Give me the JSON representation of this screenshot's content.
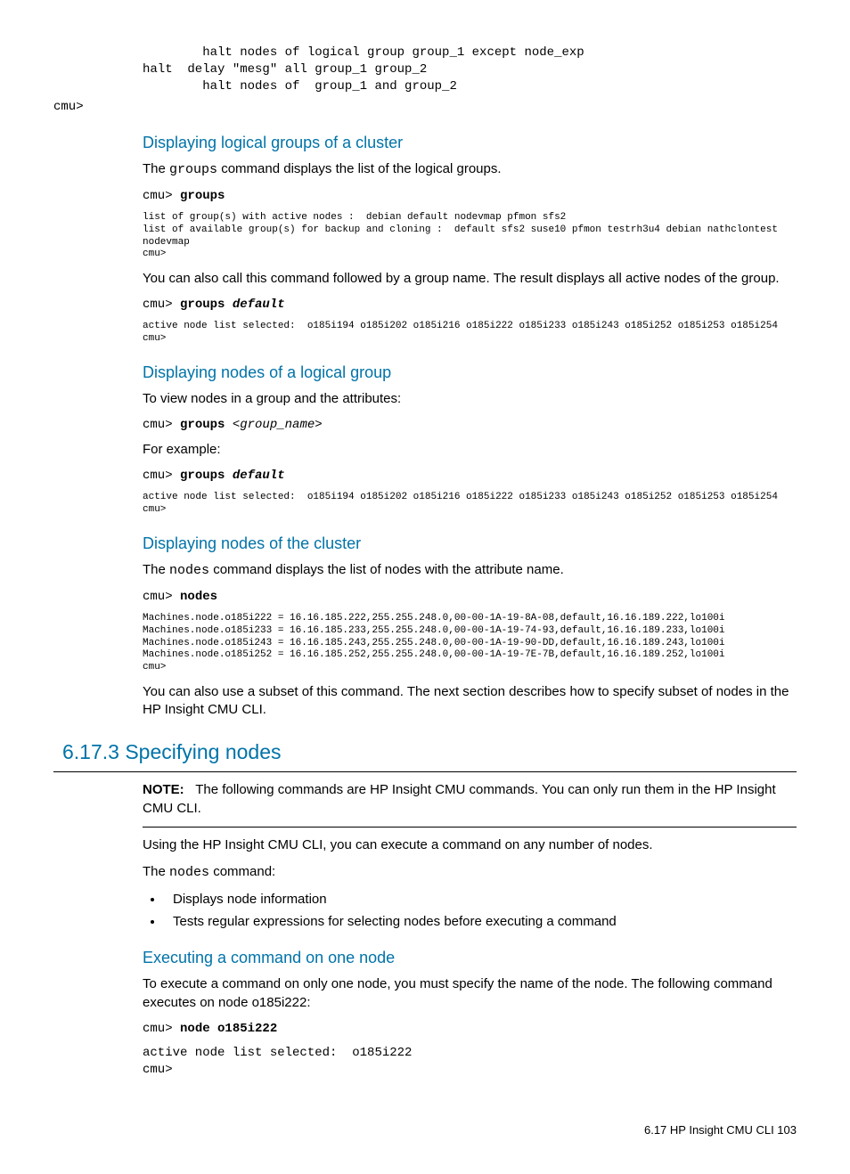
{
  "top_code": "        halt nodes of logical group group_1 except node_exp\nhalt  delay \"mesg\" all group_1 group_2\n        halt nodes of  group_1 and group_2",
  "top_prompt": "cmu>",
  "sec1": {
    "heading": "Displaying logical groups of a cluster",
    "p1a": "The ",
    "p1b": "groups",
    "p1c": " command displays the list of the logical groups.",
    "cmd1_prompt": "cmu> ",
    "cmd1_cmd": "groups",
    "out1": "list of group(s) with active nodes :  debian default nodevmap pfmon sfs2\nlist of available group(s) for backup and cloning :  default sfs2 suse10 pfmon testrh3u4 debian nathclontest nodevmap\ncmu>",
    "p2": "You can also call this command followed by a group name. The result displays all active nodes of the group.",
    "cmd2_prompt": "cmu> ",
    "cmd2_cmd": "groups ",
    "cmd2_arg": "default",
    "out2": "active node list selected:  o185i194 o185i202 o185i216 o185i222 o185i233 o185i243 o185i252 o185i253 o185i254\ncmu>"
  },
  "sec2": {
    "heading": "Displaying nodes of a logical group",
    "p1": "To view nodes in a group and the attributes:",
    "cmd1_prompt": "cmu> ",
    "cmd1_cmd": "groups ",
    "cmd1_arg": "<group_name>",
    "p2": "For example:",
    "cmd2_prompt": "cmu> ",
    "cmd2_cmd": "groups ",
    "cmd2_arg": "default",
    "out2": "active node list selected:  o185i194 o185i202 o185i216 o185i222 o185i233 o185i243 o185i252 o185i253 o185i254\ncmu>"
  },
  "sec3": {
    "heading": "Displaying nodes of the cluster",
    "p1a": "The ",
    "p1b": "nodes",
    "p1c": " command displays the list of nodes with the attribute name.",
    "cmd1_prompt": "cmu> ",
    "cmd1_cmd": "nodes",
    "out1": "Machines.node.o185i222 = 16.16.185.222,255.255.248.0,00-00-1A-19-8A-08,default,16.16.189.222,lo100i\nMachines.node.o185i233 = 16.16.185.233,255.255.248.0,00-00-1A-19-74-93,default,16.16.189.233,lo100i\nMachines.node.o185i243 = 16.16.185.243,255.255.248.0,00-00-1A-19-90-DD,default,16.16.189.243,lo100i\nMachines.node.o185i252 = 16.16.185.252,255.255.248.0,00-00-1A-19-7E-7B,default,16.16.189.252,lo100i\ncmu>",
    "p2": "You can also use a subset of this command. The next section describes how to specify subset of nodes in the HP Insight CMU CLI."
  },
  "sec4": {
    "heading": "6.17.3 Specifying nodes",
    "note_label": "NOTE:",
    "note_text": "The following commands are HP Insight CMU commands. You can only run them in the HP Insight CMU CLI.",
    "p1": "Using the HP Insight CMU CLI, you can execute a command on any number of nodes.",
    "p2a": "The ",
    "p2b": "nodes",
    "p2c": " command:",
    "li1": "Displays node information",
    "li2": "Tests regular expressions for selecting nodes before executing a command",
    "sub_heading": "Executing a command on one node",
    "p3": "To execute a command on only one node, you must specify the name of the node. The following command executes on node o185i222:",
    "cmd1_prompt": "cmu> ",
    "cmd1_cmd": "node o185i222",
    "out1": "active node list selected:  o185i222\ncmu>"
  },
  "footer": "6.17 HP Insight CMU CLI   103"
}
